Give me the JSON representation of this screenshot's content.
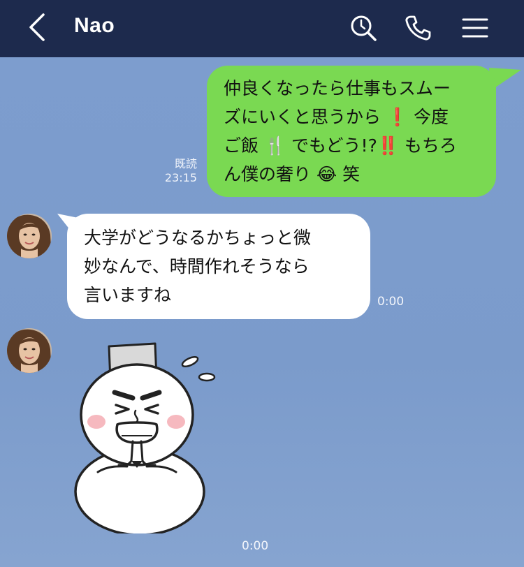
{
  "header": {
    "title": "Nao",
    "back_icon": "chevron-left-icon",
    "search_icon": "search-icon",
    "call_icon": "phone-icon",
    "menu_icon": "menu-icon",
    "background": "#1d2a4d"
  },
  "messages": [
    {
      "side": "outgoing",
      "lines": [
        "仲良くなったら仕事もスムー",
        "ズにいくと思うから ",
        "❗",
        " 今度",
        "ご飯 ",
        "🍴",
        " でもどう!?",
        "‼️",
        " もちろ",
        "ん僕の奢り ",
        "😂",
        " 笑"
      ],
      "read_label": "既読",
      "time": "23:15",
      "color": "#7ad952"
    },
    {
      "side": "incoming",
      "lines": [
        "大学がどうなるかちょっと微",
        "妙なんで、時間作れそうなら",
        "言いますね"
      ],
      "time": "0:00",
      "color": "#ffffff"
    },
    {
      "side": "incoming",
      "type": "sticker",
      "sticker": "snowman-sticker",
      "time": "0:00"
    }
  ],
  "chat_background": "#7b9ccd"
}
